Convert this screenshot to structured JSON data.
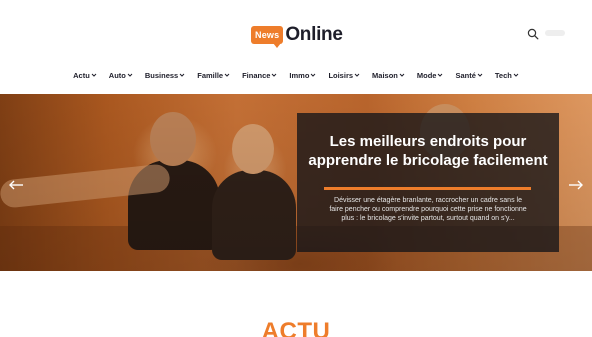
{
  "logo": {
    "badge": "News",
    "text": "Online"
  },
  "header": {
    "search_icon": "search-icon",
    "toggle": "dark-mode-toggle"
  },
  "nav": {
    "items": [
      {
        "label": "Actu"
      },
      {
        "label": "Auto"
      },
      {
        "label": "Business"
      },
      {
        "label": "Famille"
      },
      {
        "label": "Finance"
      },
      {
        "label": "Immo"
      },
      {
        "label": "Loisirs"
      },
      {
        "label": "Maison"
      },
      {
        "label": "Mode"
      },
      {
        "label": "Santé"
      },
      {
        "label": "Tech"
      }
    ],
    "chevron_icon": "chevron-down-icon"
  },
  "hero": {
    "title": "Les meilleurs endroits pour apprendre le bricolage facilement",
    "excerpt": "Dévisser une étagère branlante, raccrocher un cadre sans le faire pencher ou comprendre pourquoi cette prise ne fonctionne plus : le bricolage s'invite partout, surtout quand on s'y...",
    "prev_icon": "arrow-left-icon",
    "next_icon": "arrow-right-icon"
  },
  "section": {
    "title": "ACTU"
  },
  "colors": {
    "accent": "#ee7d2b",
    "dark": "#1e1e2a",
    "card_bg": "#141418"
  }
}
